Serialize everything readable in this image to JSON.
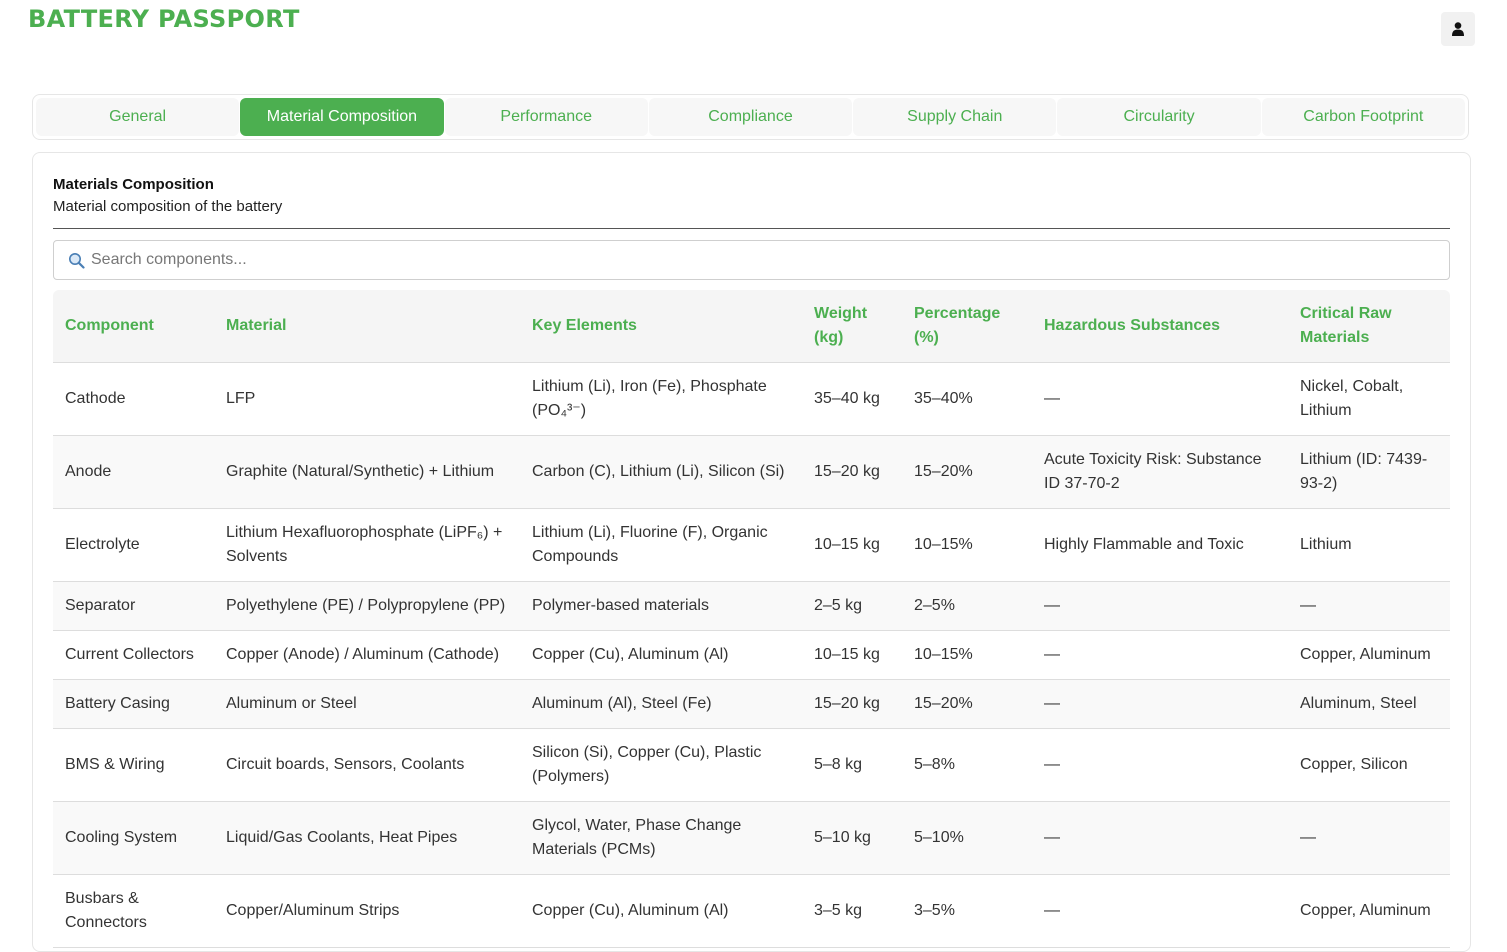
{
  "app": {
    "title": "BATTERY PASSPORT"
  },
  "tabs": [
    {
      "label": "General"
    },
    {
      "label": "Material Composition"
    },
    {
      "label": "Performance"
    },
    {
      "label": "Compliance"
    },
    {
      "label": "Supply Chain"
    },
    {
      "label": "Circularity"
    },
    {
      "label": "Carbon Footprint"
    }
  ],
  "active_tab": "Material Composition",
  "section": {
    "title": "Materials Composition",
    "subtitle": "Material composition of the battery"
  },
  "search": {
    "placeholder": "Search components..."
  },
  "icons": {
    "search": "search-icon",
    "user": "user-icon"
  },
  "colors": {
    "accent": "#4CAF50"
  },
  "table": {
    "headers": [
      "Component",
      "Material",
      "Key Elements",
      "Weight (kg)",
      "Percentage (%)",
      "Hazardous Substances",
      "Critical Raw Materials"
    ],
    "rows": [
      [
        "Cathode",
        "LFP",
        "Lithium (Li), Iron (Fe), Phosphate (PO₄³⁻)",
        "35–40 kg",
        "35–40%",
        "—",
        "Nickel, Cobalt, Lithium"
      ],
      [
        "Anode",
        "Graphite (Natural/Synthetic) + Lithium",
        "Carbon (C), Lithium (Li), Silicon (Si)",
        "15–20 kg",
        "15–20%",
        "Acute Toxicity Risk: Substance ID 37-70-2",
        "Lithium (ID: 7439-93-2)"
      ],
      [
        "Electrolyte",
        "Lithium Hexafluorophosphate (LiPF₆) + Solvents",
        "Lithium (Li), Fluorine (F), Organic Compounds",
        "10–15 kg",
        "10–15%",
        "Highly Flammable and Toxic",
        "Lithium"
      ],
      [
        "Separator",
        "Polyethylene (PE) / Polypropylene (PP)",
        "Polymer-based materials",
        "2–5 kg",
        "2–5%",
        "—",
        "—"
      ],
      [
        "Current Collectors",
        "Copper (Anode) / Aluminum (Cathode)",
        "Copper (Cu), Aluminum (Al)",
        "10–15 kg",
        "10–15%",
        "—",
        "Copper, Aluminum"
      ],
      [
        "Battery Casing",
        "Aluminum or Steel",
        "Aluminum (Al), Steel (Fe)",
        "15–20 kg",
        "15–20%",
        "—",
        "Aluminum, Steel"
      ],
      [
        "BMS & Wiring",
        "Circuit boards, Sensors, Coolants",
        "Silicon (Si), Copper (Cu), Plastic (Polymers)",
        "5–8 kg",
        "5–8%",
        "—",
        "Copper, Silicon"
      ],
      [
        "Cooling System",
        "Liquid/Gas Coolants, Heat Pipes",
        "Glycol, Water, Phase Change Materials (PCMs)",
        "5–10 kg",
        "5–10%",
        "—",
        "—"
      ],
      [
        "Busbars & Connectors",
        "Copper/Aluminum Strips",
        "Copper (Cu), Aluminum (Al)",
        "3–5 kg",
        "3–5%",
        "—",
        "Copper, Aluminum"
      ]
    ]
  }
}
